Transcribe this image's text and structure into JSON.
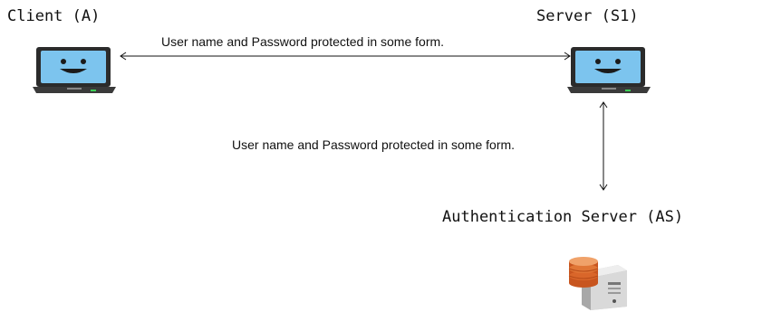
{
  "nodes": {
    "client": {
      "label": "Client (A)",
      "icon": "laptop-face-icon"
    },
    "server": {
      "label": "Server (S1)",
      "icon": "laptop-face-icon"
    },
    "auth": {
      "label": "Authentication Server (AS)",
      "icon": "database-server-icon"
    }
  },
  "edges": {
    "client_server": {
      "label": "User name and Password protected in some form."
    },
    "server_auth": {
      "label": "User name and Password protected in some form."
    }
  },
  "colors": {
    "screen": "#7cc4ee",
    "laptop_body": "#2b2b2b",
    "db_orange": "#d9662a",
    "server_gray": "#d8d8d8"
  }
}
